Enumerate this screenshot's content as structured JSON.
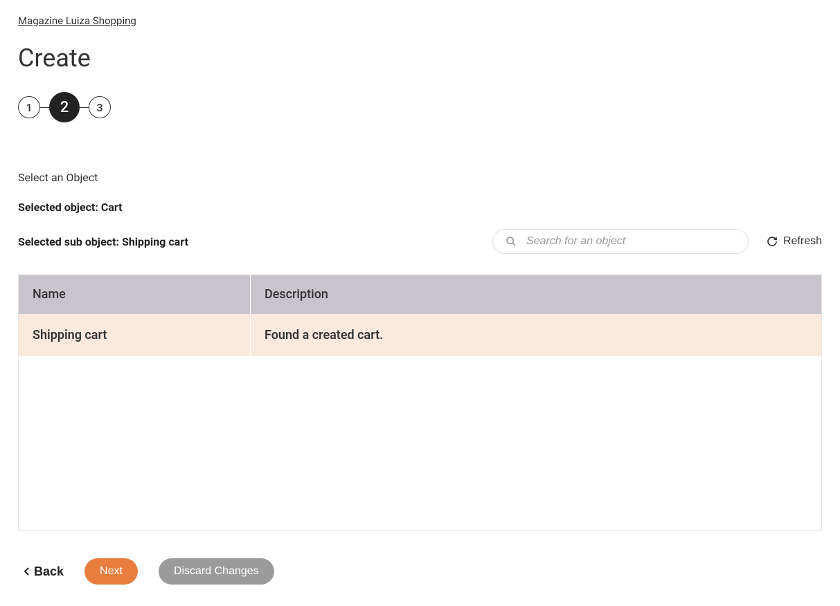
{
  "breadcrumb": "Magazine Luiza Shopping",
  "page_title": "Create",
  "stepper": {
    "step1": "1",
    "step2": "2",
    "step3": "3"
  },
  "section_label": "Select an Object",
  "selected_object": "Selected object: Cart",
  "selected_sub_object": "Selected sub object: Shipping cart",
  "search": {
    "placeholder": "Search for an object"
  },
  "refresh_label": "Refresh",
  "table": {
    "headers": {
      "name": "Name",
      "description": "Description"
    },
    "rows": [
      {
        "name": "Shipping cart",
        "description": "Found a created cart."
      }
    ]
  },
  "actions": {
    "back": "Back",
    "next": "Next",
    "discard": "Discard Changes"
  }
}
